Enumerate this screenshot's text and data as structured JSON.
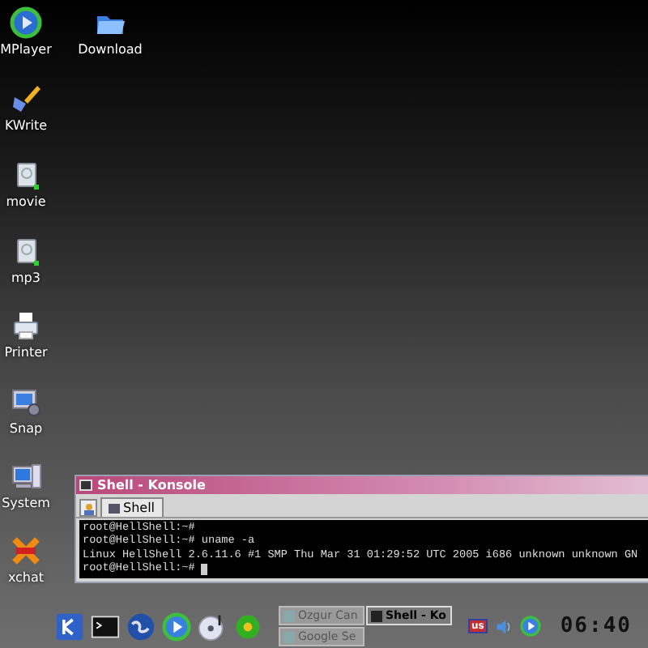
{
  "desktop_icons": [
    {
      "label": "MPlayer",
      "kind": "play"
    },
    {
      "label": "Download",
      "kind": "folder"
    },
    {
      "label": "KWrite",
      "kind": "editor"
    },
    {
      "label": "movie",
      "kind": "drive"
    },
    {
      "label": "mp3",
      "kind": "drive"
    },
    {
      "label": "Printer",
      "kind": "printer"
    },
    {
      "label": "Snap",
      "kind": "camera"
    },
    {
      "label": "System",
      "kind": "computer"
    },
    {
      "label": "xchat",
      "kind": "chat"
    }
  ],
  "window": {
    "title": "Shell - Konsole",
    "tabs": [
      {
        "label": "Shell",
        "selected": true
      }
    ],
    "lines": [
      "root@HellShell:~#",
      "root@HellShell:~# uname -a",
      "Linux HellShell 2.6.11.6 #1 SMP Thu Mar 31 01:29:52 UTC 2005 i686 unknown unknown GN",
      "root@HellShell:~# "
    ]
  },
  "taskbar": {
    "tasks": [
      {
        "label": "Ozgur Can",
        "selected": false
      },
      {
        "label": "Google Se",
        "selected": false
      },
      {
        "label": "Shell - Ko",
        "selected": true
      }
    ],
    "tray": {
      "keyboard_layout": "us"
    },
    "clock": "06:40"
  }
}
